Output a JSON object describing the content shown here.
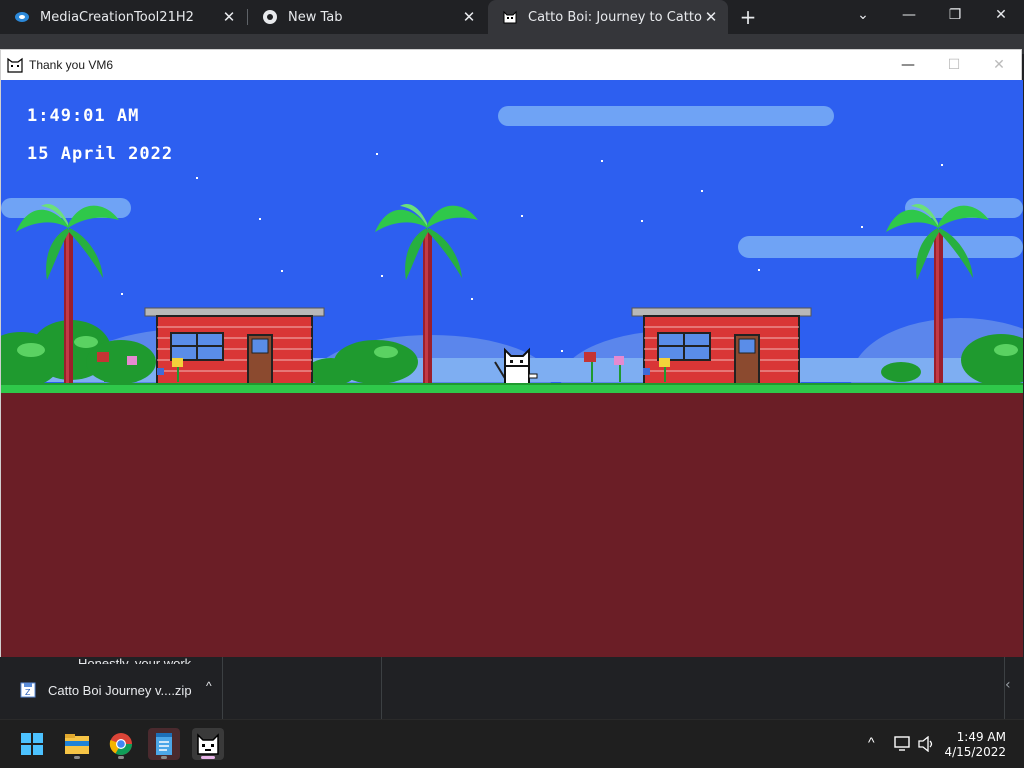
{
  "browser": {
    "tabs": [
      {
        "label": "MediaCreationTool21H2",
        "icon": "media-creation-tool-icon"
      },
      {
        "label": "New Tab",
        "icon": "chrome-icon"
      },
      {
        "label": "Catto Boi: Journey to Catto Land",
        "icon": "cat-face-icon"
      }
    ],
    "new_tab_glyph": "+",
    "window_controls": {
      "dropdown": "⌄",
      "minimize": "—",
      "restore": "❐",
      "close": "✕"
    }
  },
  "game_window": {
    "title": "Thank you VM6",
    "controls": {
      "minimize": "—",
      "maximize": "☐",
      "close": "✕"
    },
    "hud": {
      "time": "1:49:01 AM",
      "date": "15 April 2022"
    },
    "colors": {
      "sky": "#2d5ff0",
      "ground": "#6b1e26",
      "grass": "#2fc84a",
      "brick": "#d93636"
    }
  },
  "behind_text": "Honestly, your work",
  "downloads": {
    "item_label": "Catto Boi Journey v....zip",
    "chevron": "^"
  },
  "taskbar": {
    "apps": [
      "windows-start",
      "file-explorer",
      "chrome",
      "notepad",
      "catto-boi"
    ],
    "time": "1:49 AM",
    "date": "4/15/2022"
  }
}
